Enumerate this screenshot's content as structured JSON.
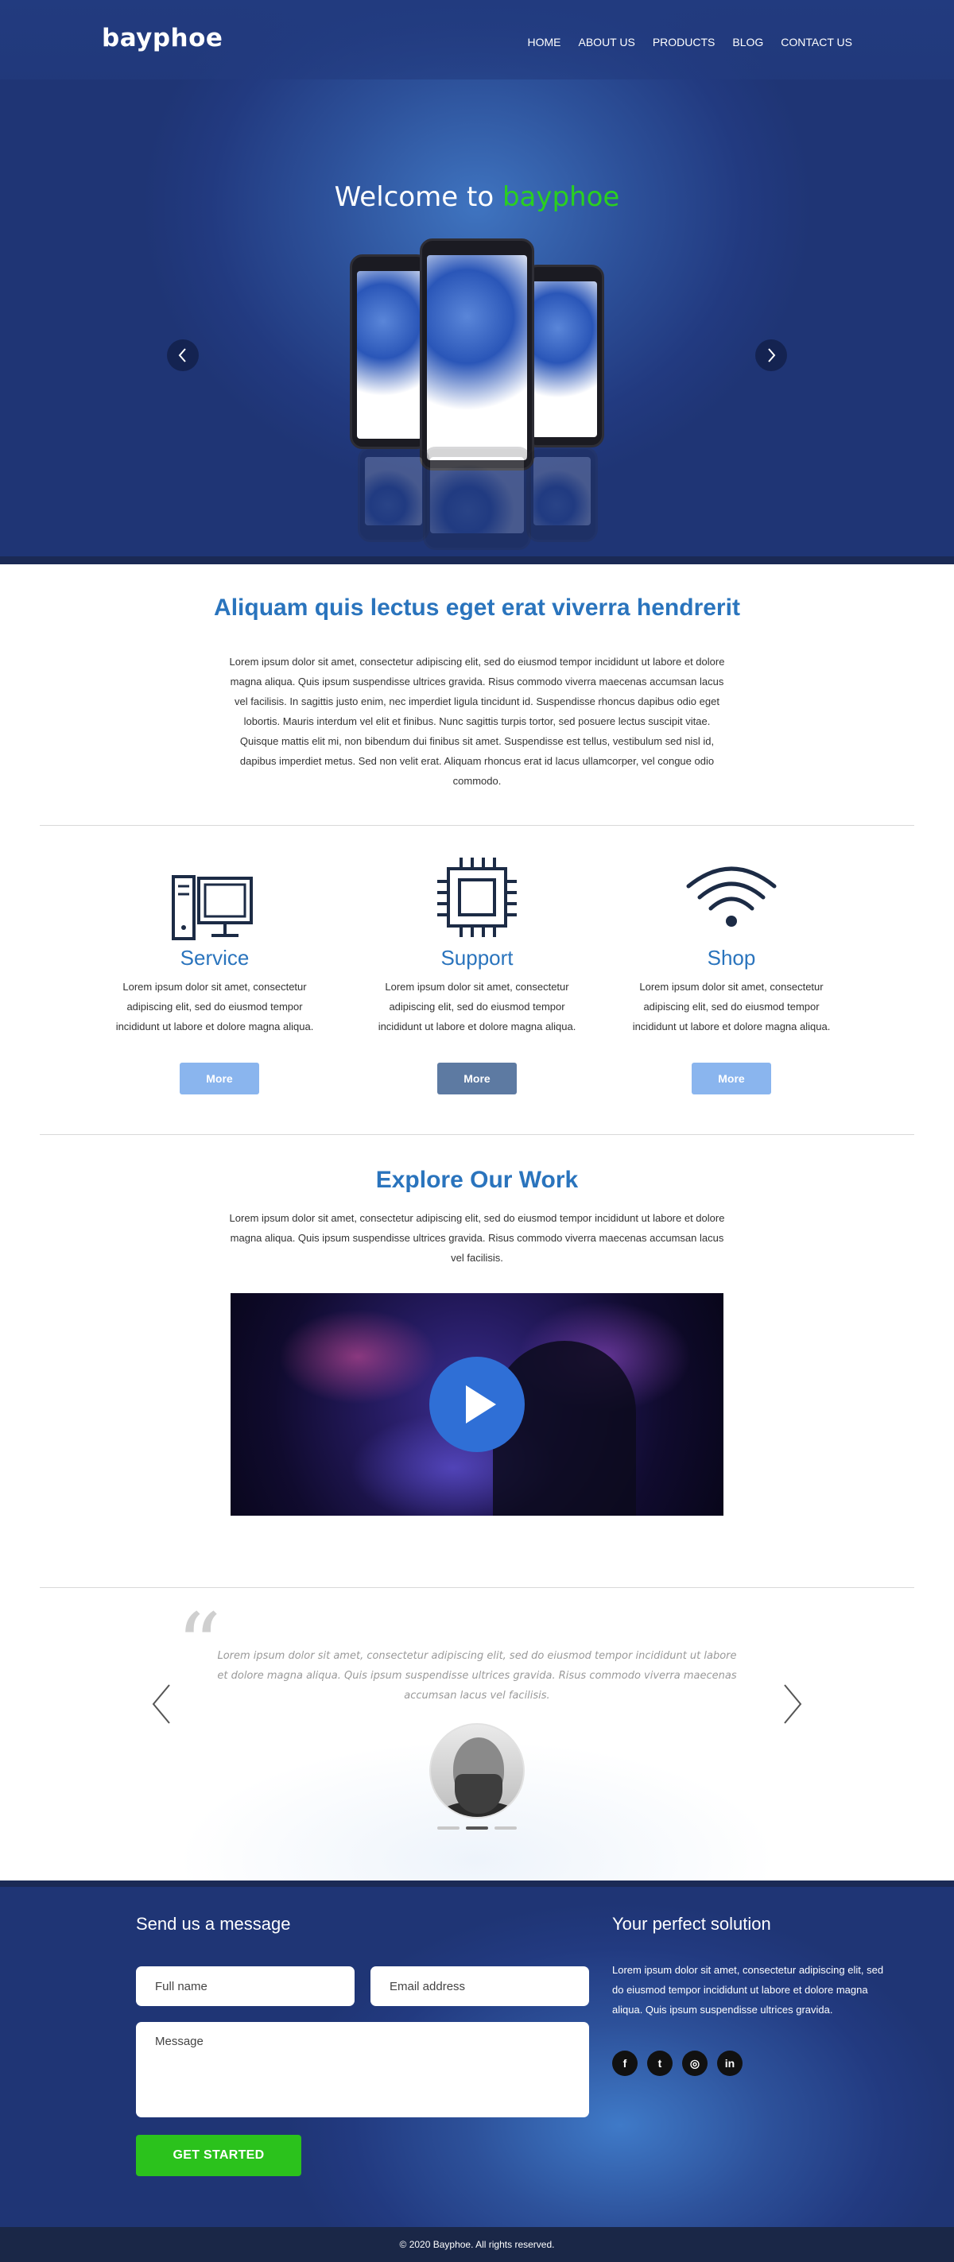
{
  "brand": "bayphoe",
  "nav": [
    "HOME",
    "ABOUT US",
    "PRODUCTS",
    "BLOG",
    "CONTACT US"
  ],
  "hero": {
    "title_prefix": "Welcome to ",
    "title_accent": "bayphoe",
    "accent_color": "#2ad01f",
    "prev_icon": "chevron-left-icon",
    "next_icon": "chevron-right-icon"
  },
  "intro": {
    "title": "Aliquam quis lectus eget erat viverra hendrerit",
    "text": "Lorem ipsum dolor sit amet, consectetur adipiscing elit, sed do eiusmod tempor incididunt ut labore et dolore magna aliqua. Quis ipsum suspendisse ultrices gravida. Risus commodo viverra maecenas accumsan lacus vel facilisis. In sagittis justo enim, nec imperdiet ligula tincidunt id. Suspendisse rhoncus dapibus odio eget lobortis. Mauris interdum vel elit et finibus. Nunc sagittis turpis tortor, sed posuere lectus suscipit vitae. Quisque mattis elit mi, non bibendum dui finibus sit amet. Suspendisse est tellus, vestibulum sed nisl id, dapibus imperdiet metus. Sed non velit erat. Aliquam rhoncus erat id lacus ullamcorper, vel congue odio commodo."
  },
  "features": [
    {
      "name": "Service",
      "icon": "computer-icon",
      "desc": "Lorem ipsum dolor sit amet, consectetur adipiscing elit, sed do eiusmod tempor incididunt ut labore et dolore magna aliqua.",
      "button": "More"
    },
    {
      "name": "Support",
      "icon": "chip-icon",
      "desc": "Lorem ipsum dolor sit amet, consectetur adipiscing elit, sed do eiusmod tempor incididunt ut labore et dolore magna aliqua.",
      "button": "More"
    },
    {
      "name": "Shop",
      "icon": "wifi-icon",
      "desc": "Lorem ipsum dolor sit amet, consectetur adipiscing elit, sed do eiusmod tempor incididunt ut labore et dolore magna aliqua.",
      "button": "More"
    }
  ],
  "explore": {
    "title": "Explore Our Work",
    "text": "Lorem ipsum dolor sit amet, consectetur adipiscing elit, sed do eiusmod tempor incididunt ut labore et dolore magna aliqua. Quis ipsum suspendisse ultrices gravida. Risus commodo viverra maecenas accumsan lacus vel facilisis.",
    "play_icon": "play-icon"
  },
  "testimonial": {
    "quote": "Lorem ipsum dolor sit amet, consectetur adipiscing elit, sed do eiusmod tempor incididunt ut labore et dolore magna aliqua. Quis ipsum suspendisse ultrices gravida. Risus commodo viverra maecenas accumsan lacus vel facilisis.",
    "prev": "‹",
    "next": "›",
    "quote_mark": "“",
    "active_dot": 2,
    "dot_count": 3
  },
  "contact": {
    "title": "Send us a message",
    "fullname_placeholder": "Full name",
    "email_placeholder": "Email address",
    "message_placeholder": "Message",
    "button": "GET STARTED",
    "solution_title": "Your perfect solution",
    "solution_text": "Lorem ipsum dolor sit amet, consectetur adipiscing elit, sed do eiusmod tempor incididunt ut labore et dolore magna aliqua. Quis ipsum suspendisse ultrices gravida.",
    "social": [
      {
        "icon": "facebook-icon",
        "glyph": "f"
      },
      {
        "icon": "twitter-icon",
        "glyph": "t"
      },
      {
        "icon": "instagram-icon",
        "glyph": "◎"
      },
      {
        "icon": "linkedin-icon",
        "glyph": "in"
      }
    ]
  },
  "footer": "© 2020 Bayphoe. All rights reserved."
}
